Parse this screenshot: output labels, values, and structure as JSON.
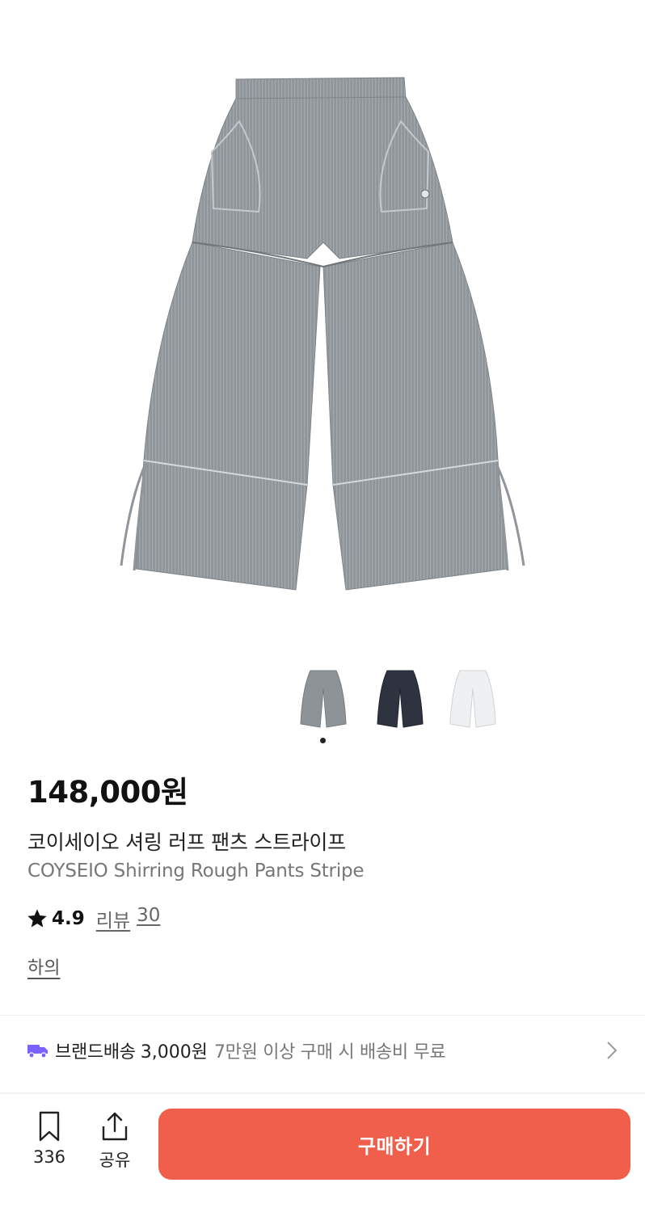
{
  "product": {
    "price": "148,000원",
    "name_ko": "코이세이오 셔링 러프 팬츠 스트라이프",
    "name_en": "COYSEIO Shirring Rough Pants Stripe",
    "rating": "4.9",
    "review_label": "리뷰",
    "review_count": "30",
    "category": "하의",
    "image_icon": "pants-product-image"
  },
  "gallery": {
    "thumbnails": [
      {
        "color_name": "gray",
        "color": "#8e9398"
      },
      {
        "color_name": "navy",
        "color": "#2f3340"
      },
      {
        "color_name": "white",
        "color": "#eef0f1"
      }
    ],
    "selected_index": 0
  },
  "shipping": {
    "label": "브랜드배송",
    "fee": "3,000원",
    "note": "7만원 이상 구매 시 배송비 무료",
    "icon": "truck-icon",
    "icon_color": "#7b61ff"
  },
  "bottom_bar": {
    "bookmark_count": "336",
    "share_label": "공유",
    "buy_label": "구매하기",
    "buy_color": "#ef5f4b"
  }
}
